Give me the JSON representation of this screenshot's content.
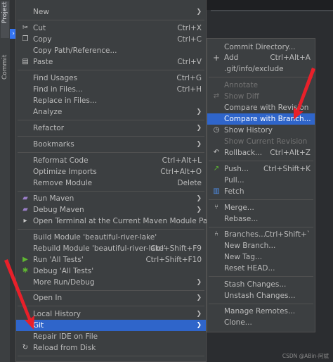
{
  "sidebar": {
    "project_tab": "Project",
    "commit_tab": "Commit"
  },
  "main_menu": {
    "items": [
      {
        "label": "New",
        "shortcut": "",
        "submenu": true
      },
      {
        "label": "Cut",
        "shortcut": "Ctrl+X",
        "icon": "scissors-icon"
      },
      {
        "label": "Copy",
        "shortcut": "Ctrl+C",
        "icon": "copy-icon"
      },
      {
        "label": "Copy Path/Reference...",
        "shortcut": ""
      },
      {
        "label": "Paste",
        "shortcut": "Ctrl+V",
        "icon": "paste-icon"
      },
      {
        "label": "Find Usages",
        "shortcut": "Ctrl+G"
      },
      {
        "label": "Find in Files...",
        "shortcut": "Ctrl+H"
      },
      {
        "label": "Replace in Files...",
        "shortcut": ""
      },
      {
        "label": "Analyze",
        "shortcut": "",
        "submenu": true
      },
      {
        "label": "Refactor",
        "shortcut": "",
        "submenu": true
      },
      {
        "label": "Bookmarks",
        "shortcut": "",
        "submenu": true
      },
      {
        "label": "Reformat Code",
        "shortcut": "Ctrl+Alt+L"
      },
      {
        "label": "Optimize Imports",
        "shortcut": "Ctrl+Alt+O"
      },
      {
        "label": "Remove Module",
        "shortcut": "Delete"
      },
      {
        "label": "Run Maven",
        "shortcut": "",
        "submenu": true,
        "icon": "maven-icon"
      },
      {
        "label": "Debug Maven",
        "shortcut": "",
        "submenu": true,
        "icon": "maven-icon"
      },
      {
        "label": "Open Terminal at the Current Maven Module Path",
        "shortcut": "",
        "icon": "terminal-icon"
      },
      {
        "label": "Build Module 'beautiful-river-lake'",
        "shortcut": ""
      },
      {
        "label": "Rebuild Module 'beautiful-river-lake'",
        "shortcut": "Ctrl+Shift+F9"
      },
      {
        "label": "Run 'All Tests'",
        "shortcut": "Ctrl+Shift+F10",
        "icon": "run-icon"
      },
      {
        "label": "Debug 'All Tests'",
        "shortcut": "",
        "icon": "debug-icon"
      },
      {
        "label": "More Run/Debug",
        "shortcut": "",
        "submenu": true
      },
      {
        "label": "Open In",
        "shortcut": "",
        "submenu": true
      },
      {
        "label": "Local History",
        "shortcut": "",
        "submenu": true
      },
      {
        "label": "Git",
        "shortcut": "",
        "submenu": true
      },
      {
        "label": "Repair IDE on File",
        "shortcut": ""
      },
      {
        "label": "Reload from Disk",
        "shortcut": "",
        "icon": "reload-icon"
      }
    ]
  },
  "git_menu": {
    "items": [
      {
        "label": "Commit Directory...",
        "shortcut": ""
      },
      {
        "label": "Add",
        "shortcut": "Ctrl+Alt+A",
        "icon": "plus-icon"
      },
      {
        "label": ".git/info/exclude",
        "shortcut": ""
      },
      {
        "label": "Annotate",
        "shortcut": "",
        "disabled": true
      },
      {
        "label": "Show Diff",
        "shortcut": "",
        "disabled": true,
        "icon": "diff-icon"
      },
      {
        "label": "Compare with Revision",
        "shortcut": ""
      },
      {
        "label": "Compare with Branch...",
        "shortcut": ""
      },
      {
        "label": "Show History",
        "shortcut": "",
        "icon": "history-icon"
      },
      {
        "label": "Show Current Revision",
        "shortcut": "",
        "disabled": true
      },
      {
        "label": "Rollback...",
        "shortcut": "Ctrl+Alt+Z",
        "icon": "rollback-icon"
      },
      {
        "label": "Push...",
        "shortcut": "Ctrl+Shift+K",
        "icon": "push-icon"
      },
      {
        "label": "Pull...",
        "shortcut": ""
      },
      {
        "label": "Fetch",
        "shortcut": "",
        "icon": "fetch-icon"
      },
      {
        "label": "Merge...",
        "shortcut": "",
        "icon": "merge-icon"
      },
      {
        "label": "Rebase...",
        "shortcut": ""
      },
      {
        "label": "Branches...",
        "shortcut": "Ctrl+Shift+`",
        "icon": "branch-icon"
      },
      {
        "label": "New Branch...",
        "shortcut": ""
      },
      {
        "label": "New Tag...",
        "shortcut": ""
      },
      {
        "label": "Reset HEAD...",
        "shortcut": ""
      },
      {
        "label": "Stash Changes...",
        "shortcut": ""
      },
      {
        "label": "Unstash Changes...",
        "shortcut": ""
      },
      {
        "label": "Manage Remotes...",
        "shortcut": ""
      },
      {
        "label": "Clone...",
        "shortcut": ""
      }
    ]
  },
  "selection": {
    "main": "Git",
    "submenu": "Compare with Branch..."
  },
  "colors": {
    "selection": "#2f65ca",
    "menu_bg": "#3c3f41",
    "annotation_arrow": "#e8202a"
  },
  "watermark": "CSDN @ABin-阿斌"
}
